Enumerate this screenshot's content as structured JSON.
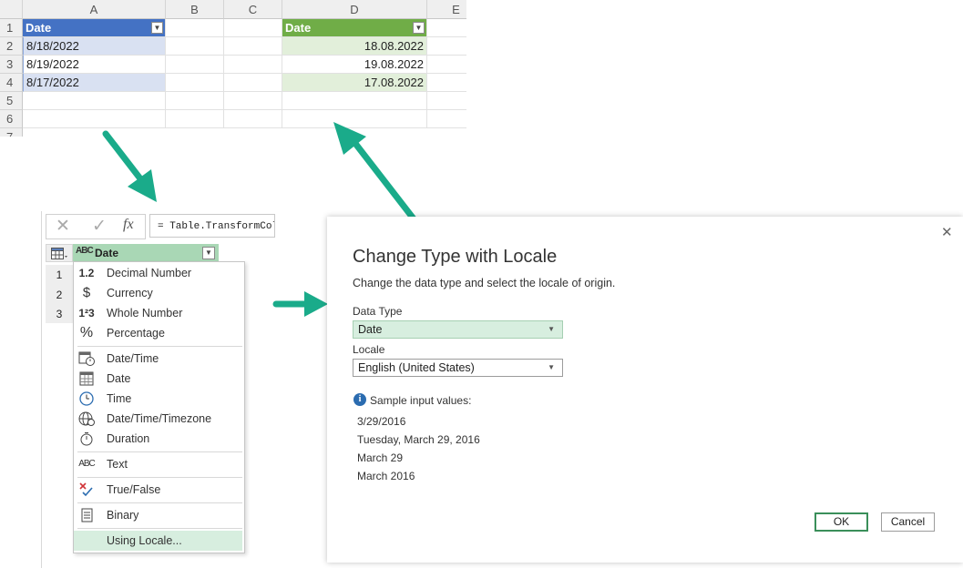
{
  "sheet": {
    "columns": [
      "A",
      "B",
      "C",
      "D",
      "E"
    ],
    "rows": [
      "1",
      "2",
      "3",
      "4",
      "5",
      "6",
      "7"
    ],
    "left_table": {
      "header": "Date",
      "values": [
        "8/18/2022",
        "8/19/2022",
        "8/17/2022"
      ]
    },
    "right_table": {
      "header": "Date",
      "values": [
        "18.08.2022",
        "19.08.2022",
        "17.08.2022"
      ]
    }
  },
  "power_query": {
    "formula": "= Table.TransformCol",
    "fx_label": "fx",
    "column_header": "Date",
    "type_badge": "ABC",
    "row_numbers": [
      "1",
      "2",
      "3"
    ],
    "menu_items": [
      {
        "icon": "1.2",
        "label": "Decimal Number"
      },
      {
        "icon": "$",
        "label": "Currency"
      },
      {
        "icon": "1²3",
        "label": "Whole Number"
      },
      {
        "icon": "%",
        "label": "Percentage"
      },
      {
        "icon": "datetime-icon",
        "label": "Date/Time"
      },
      {
        "icon": "calendar-icon",
        "label": "Date"
      },
      {
        "icon": "clock-icon",
        "label": "Time"
      },
      {
        "icon": "globe-clock-icon",
        "label": "Date/Time/Timezone"
      },
      {
        "icon": "stopwatch-icon",
        "label": "Duration"
      },
      {
        "icon": "ABC",
        "label": "Text"
      },
      {
        "icon": "true-false-icon",
        "label": "True/False"
      },
      {
        "icon": "binary-icon",
        "label": "Binary"
      },
      {
        "icon": "",
        "label": "Using Locale..."
      }
    ]
  },
  "dialog": {
    "title": "Change Type with Locale",
    "subtitle": "Change the data type and select the locale of origin.",
    "data_type_label": "Data Type",
    "data_type_value": "Date",
    "locale_label": "Locale",
    "locale_value": "English (United States)",
    "sample_label": "Sample input values:",
    "samples": [
      "3/29/2016",
      "Tuesday, March 29, 2016",
      "March 29",
      "March 2016"
    ],
    "ok_label": "OK",
    "cancel_label": "Cancel",
    "close_glyph": "✕"
  },
  "colors": {
    "header_blue": "#4472c4",
    "row_blue": "#d9e1f2",
    "header_green": "#70ad47",
    "row_green": "#e2efda",
    "arrow_teal": "#1aab8a",
    "selection_green": "#d7eedf"
  }
}
